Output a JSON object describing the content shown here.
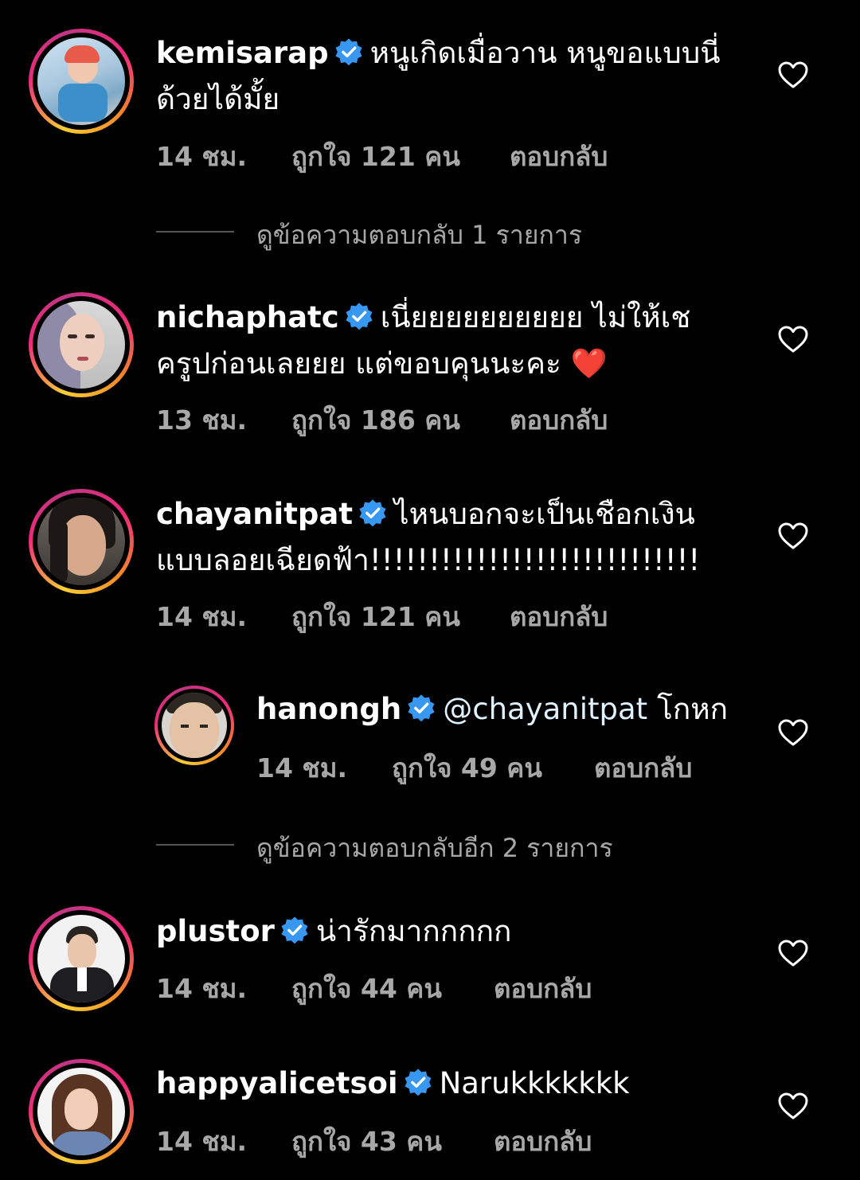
{
  "comments": [
    {
      "username": "kemisarap",
      "text_line1": "หนูเกิดเมื่อวาน หนูขอแบบนี่",
      "text_line2": "ด้วยได้มั้ย",
      "time": "14 ชม.",
      "likes": "ถูกใจ 121 คน",
      "reply": "ตอบกลับ"
    },
    {
      "username": "nichaphatc",
      "text_line1": "เนี่ยยยยยยยยยย ไม่ให้เช",
      "text_line2": "ครูปก่อนเลยยย  แต่ขอบคุนนะคะ",
      "emoji": "❤️",
      "time": "13 ชม.",
      "likes": "ถูกใจ 186 คน",
      "reply": "ตอบกลับ"
    },
    {
      "username": "chayanitpat",
      "text_line1": "ไหนบอกจะเป็นเชือกเงิน",
      "text_line2": "แบบลอยเฉียดฟ้า!!!!!!!!!!!!!!!!!!!!!!!!!!!!",
      "time": "14 ชม.",
      "likes": "ถูกใจ 121 คน",
      "reply": "ตอบกลับ"
    },
    {
      "username": "plustor",
      "text_line1": "น่ารักมากกกกก",
      "time": "14 ชม.",
      "likes": "ถูกใจ 44 คน",
      "reply": "ตอบกลับ"
    },
    {
      "username": "happyalicetsoi",
      "text_line1": "Narukkkkkkk",
      "time": "14 ชม.",
      "likes": "ถูกใจ 43 คน",
      "reply": "ตอบกลับ"
    }
  ],
  "reply_hanongh": {
    "username": "hanongh",
    "mention": "@chayanitpat",
    "text": " โกหก",
    "time": "14 ชม.",
    "likes": "ถูกใจ 49 คน",
    "reply": "ตอบกลับ"
  },
  "view_replies_1": "ดูข้อความตอบกลับ 1 รายการ",
  "view_replies_2": "ดูข้อความตอบกลับอีก 2 รายการ",
  "colors": {
    "background": "#000000",
    "verified_badge": "#3897f0",
    "meta_text": "#a8a8a8",
    "heart_emoji": "#e8212e"
  },
  "icons": [
    "verified-badge-icon",
    "heart-outline-icon"
  ]
}
